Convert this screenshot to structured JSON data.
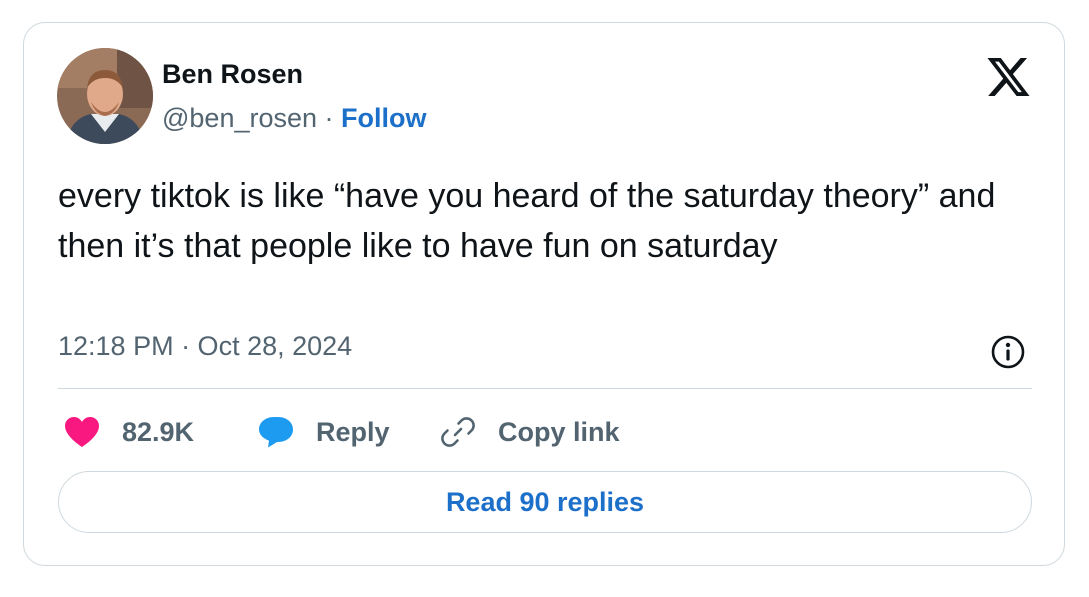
{
  "author": {
    "name": "Ben Rosen",
    "handle": "@ben_rosen",
    "separator": "·",
    "follow_label": "Follow"
  },
  "tweet": {
    "text": "every tiktok is like “have you heard of the saturday theory” and then it’s that people like to have fun on saturday",
    "timestamp": "12:18 PM · Oct 28, 2024"
  },
  "actions": {
    "like_count": "82.9K",
    "reply_label": "Reply",
    "copy_link_label": "Copy link"
  },
  "footer": {
    "read_replies_label": "Read 90 replies"
  },
  "icons": {
    "like": "heart-icon",
    "reply": "speech-bubble-icon",
    "copy": "link-icon",
    "info": "info-icon",
    "brand": "x-logo-icon"
  },
  "colors": {
    "like": "#f91880",
    "reply": "#1d9bf0",
    "link": "#1d70c9",
    "text": "#0f1419",
    "muted": "#536471",
    "border": "#cfd9de"
  }
}
